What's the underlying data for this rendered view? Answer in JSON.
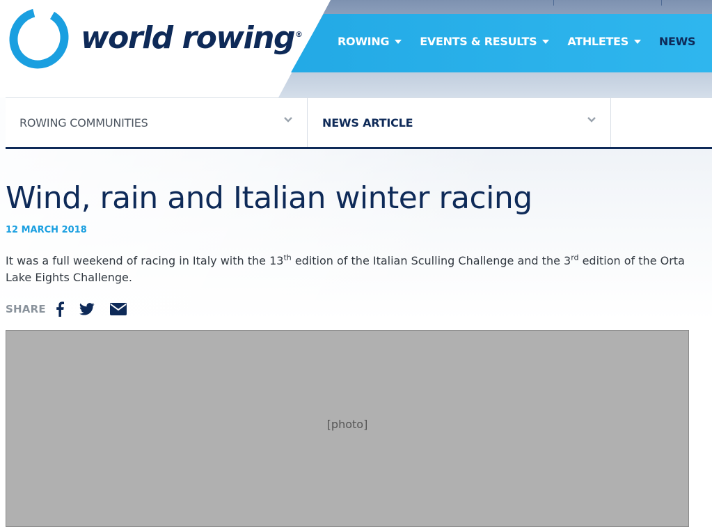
{
  "logo": {
    "text": "world rowing",
    "mark": "®"
  },
  "nav": {
    "items": [
      {
        "label": "ROWING",
        "has_dropdown": true
      },
      {
        "label": "EVENTS & RESULTS",
        "has_dropdown": true
      },
      {
        "label": "ATHLETES",
        "has_dropdown": true
      },
      {
        "label": "NEWS",
        "has_dropdown": false
      }
    ]
  },
  "subnav": {
    "section": "ROWING COMMUNITIES",
    "page": "NEWS ARTICLE"
  },
  "article": {
    "title": "Wind, rain and Italian winter racing",
    "date": "12 MARCH 2018",
    "intro_part1": "It was a full weekend of racing in Italy with the 13",
    "intro_sup1": "th",
    "intro_part2": " edition of the Italian Sculling Challenge and the 3",
    "intro_sup2": "rd",
    "intro_part3": " edition of the Orta Lake Eights Challenge."
  },
  "share": {
    "label": "SHARE",
    "icons": [
      "facebook-icon",
      "twitter-icon",
      "email-icon"
    ]
  },
  "colors": {
    "navy": "#0e2a58",
    "brand_blue": "#1a9fe0",
    "text": "#333a42",
    "muted": "#8a939c"
  }
}
